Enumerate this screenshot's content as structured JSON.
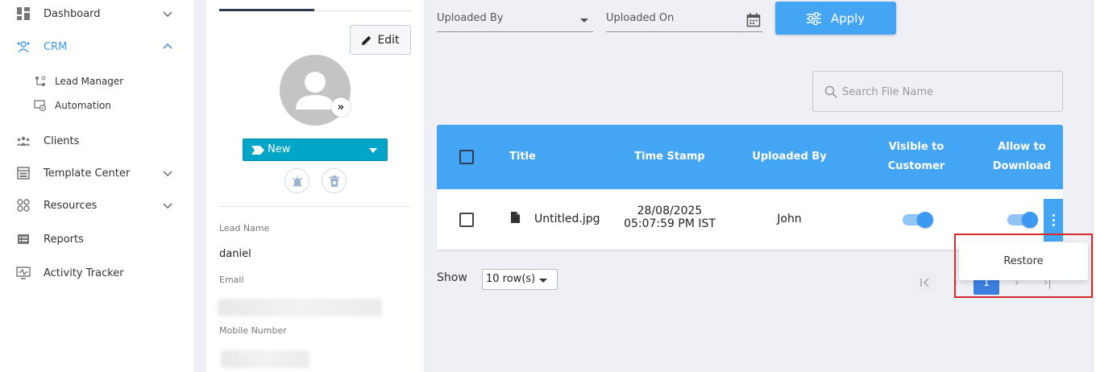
{
  "sidebar": {
    "items": [
      {
        "label": "Dashboard",
        "icon": "dashboard-icon"
      },
      {
        "label": "CRM",
        "icon": "crm-icon",
        "active": true
      },
      {
        "label": "Clients",
        "icon": "clients-icon"
      },
      {
        "label": "Template Center",
        "icon": "template-icon"
      },
      {
        "label": "Resources",
        "icon": "resources-icon"
      },
      {
        "label": "Reports",
        "icon": "reports-icon"
      },
      {
        "label": "Activity Tracker",
        "icon": "activity-icon"
      }
    ],
    "crm_sub": [
      {
        "label": "Lead Manager",
        "icon": "lead-manager-icon"
      },
      {
        "label": "Automation",
        "icon": "automation-icon"
      }
    ]
  },
  "lead": {
    "edit_label": "Edit",
    "status": "New",
    "lead_name_label": "Lead Name",
    "lead_name": "daniel",
    "email_label": "Email",
    "mobile_label": "Mobile Number"
  },
  "filters": {
    "uploaded_by": "Uploaded By",
    "uploaded_on": "Uploaded On",
    "apply_label": "Apply"
  },
  "search": {
    "placeholder": "Search File Name"
  },
  "table": {
    "headers": {
      "title": "Title",
      "timestamp": "Time Stamp",
      "uploaded_by": "Uploaded By",
      "visible_1": "Visible to",
      "visible_2": "Customer",
      "allow_1": "Allow to",
      "allow_2": "Download"
    },
    "rows": [
      {
        "title": "Untitled.jpg",
        "date": "28/08/2025",
        "time": "05:07:59 PM IST",
        "uploaded_by": "John",
        "visible": true,
        "download": true
      }
    ]
  },
  "pagination": {
    "show_label": "Show",
    "rows_per_page": "10 row(s)",
    "current_page": "1"
  },
  "context_menu": {
    "restore_label": "Restore"
  },
  "colors": {
    "accent": "#45a5f5",
    "status": "#00a5c8",
    "highlight": "#d62b2b"
  }
}
